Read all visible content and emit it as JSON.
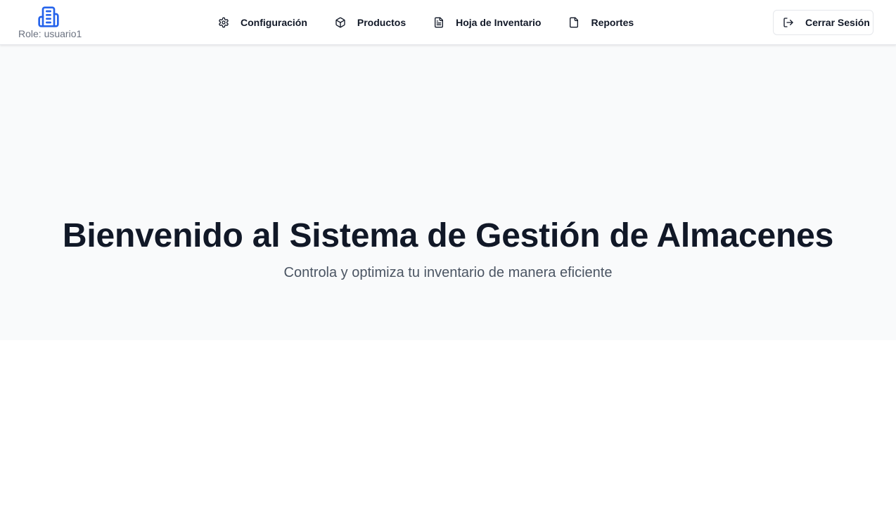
{
  "header": {
    "role_label": "Role: usuario1",
    "brand_icon": "building-icon",
    "brand_color": "#2563eb",
    "nav_items": [
      {
        "label": "Configuración",
        "icon": "gear-icon"
      },
      {
        "label": "Productos",
        "icon": "box-icon"
      },
      {
        "label": "Hoja de Inventario",
        "icon": "file-text-icon"
      },
      {
        "label": "Reportes",
        "icon": "file-icon"
      }
    ],
    "logout_label": "Cerrar Sesión",
    "logout_icon": "logout-icon"
  },
  "hero": {
    "title": "Bienvenido al Sistema de Gestión de Almacenes",
    "subtitle": "Controla y optimiza tu inventario de manera eficiente",
    "background": "#f9fafb"
  }
}
